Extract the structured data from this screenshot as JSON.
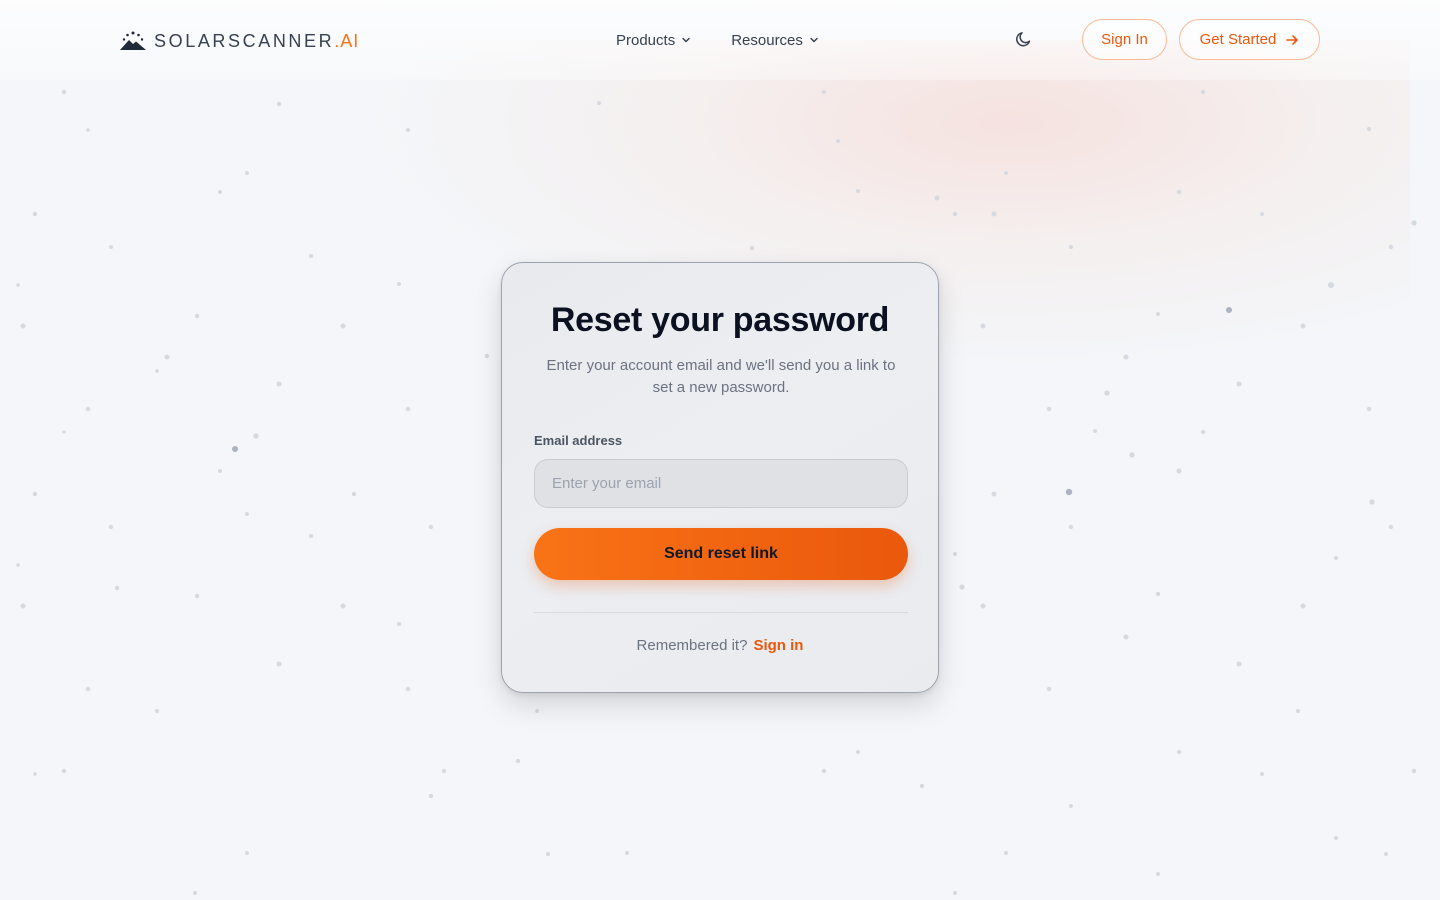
{
  "brand": {
    "name": "SOLARSCANNER",
    "suffix": ".AI",
    "accent_color": "#f97316"
  },
  "nav": {
    "items": [
      {
        "label": "Products"
      },
      {
        "label": "Resources"
      }
    ]
  },
  "header": {
    "theme_toggle_icon": "moon-icon",
    "sign_in_label": "Sign In",
    "get_started_label": "Get Started"
  },
  "reset_form": {
    "title": "Reset your password",
    "subtitle": "Enter your account email and we'll send you a link to set a new password.",
    "email_label": "Email address",
    "email_placeholder": "Enter your email",
    "email_value": "",
    "submit_label": "Send reset link",
    "remember_text": "Remembered it?",
    "sign_in_link": "Sign in"
  }
}
